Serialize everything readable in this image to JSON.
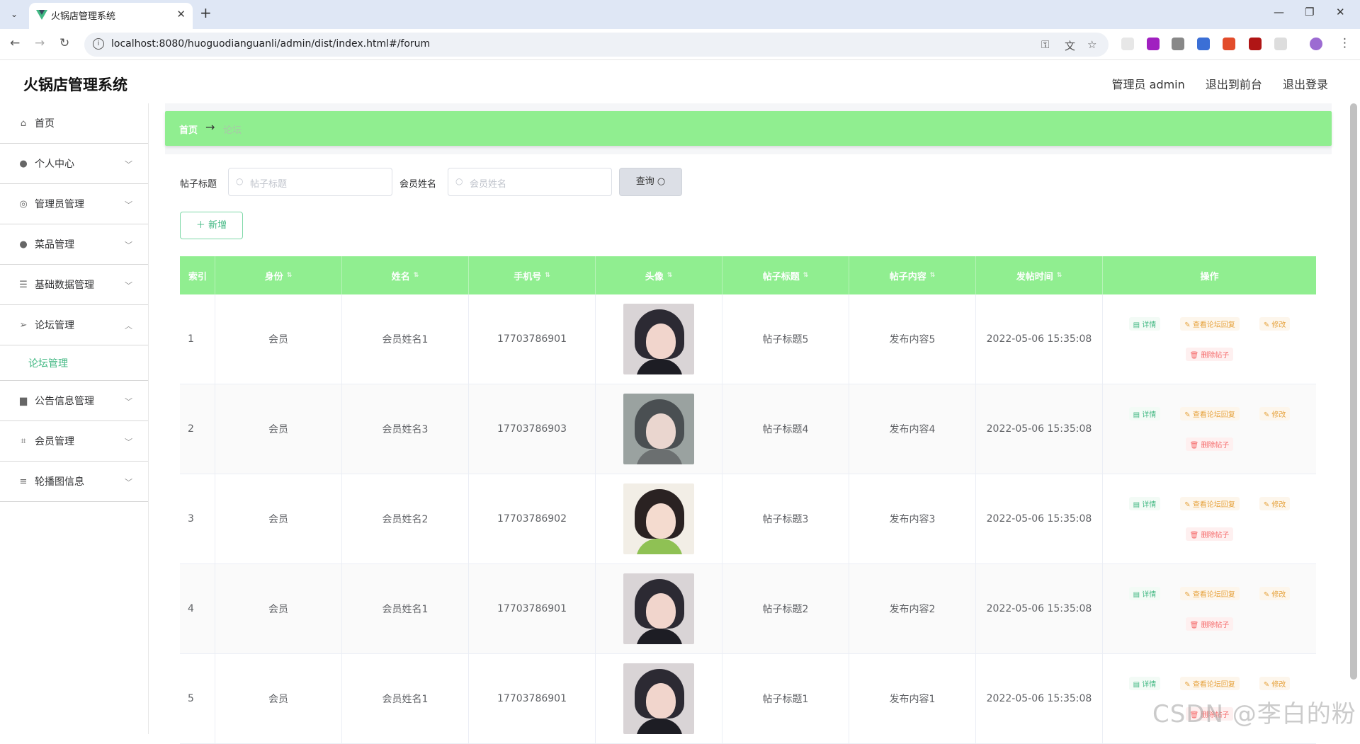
{
  "browser": {
    "tab_title": "火锅店管理系统",
    "url": "localhost:8080/huoguodianguanli/admin/dist/index.html#/forum"
  },
  "app": {
    "title": "火锅店管理系统",
    "admin_label": "管理员 admin",
    "goto_front": "退出到前台",
    "logout": "退出登录"
  },
  "sidebar": {
    "items": [
      {
        "label": "首页",
        "icon": "home-icon"
      },
      {
        "label": "个人中心",
        "icon": "user-icon"
      },
      {
        "label": "管理员管理",
        "icon": "compass-icon"
      },
      {
        "label": "菜品管理",
        "icon": "user-icon"
      },
      {
        "label": "基础数据管理",
        "icon": "list-icon"
      },
      {
        "label": "论坛管理",
        "icon": "send-icon"
      },
      {
        "label": "公告信息管理",
        "icon": "briefcase-icon"
      },
      {
        "label": "会员管理",
        "icon": "crop-icon"
      },
      {
        "label": "轮播图信息",
        "icon": "menu-icon"
      }
    ],
    "submenu_label": "论坛管理"
  },
  "breadcrumb": {
    "home": "首页",
    "current": "论坛"
  },
  "search": {
    "title_label": "帖子标题",
    "title_placeholder": "帖子标题",
    "name_label": "会员姓名",
    "name_placeholder": "会员姓名",
    "query_button": "查询"
  },
  "add_button": "新增",
  "table": {
    "headers": [
      "索引",
      "身份",
      "姓名",
      "手机号",
      "头像",
      "帖子标题",
      "帖子内容",
      "发帖时间",
      "操作"
    ],
    "rows": [
      {
        "index": "1",
        "role": "会员",
        "name": "会员姓名1",
        "phone": "17703786901",
        "title": "帖子标题5",
        "content": "发布内容5",
        "time": "2022-05-06 15:35:08",
        "avatar": "dark-hair"
      },
      {
        "index": "2",
        "role": "会员",
        "name": "会员姓名3",
        "phone": "17703786903",
        "title": "帖子标题4",
        "content": "发布内容4",
        "time": "2022-05-06 15:35:08",
        "avatar": "grey-hair"
      },
      {
        "index": "3",
        "role": "会员",
        "name": "会员姓名2",
        "phone": "17703786902",
        "title": "帖子标题3",
        "content": "发布内容3",
        "time": "2022-05-06 15:35:08",
        "avatar": "green-sweater"
      },
      {
        "index": "4",
        "role": "会员",
        "name": "会员姓名1",
        "phone": "17703786901",
        "title": "帖子标题2",
        "content": "发布内容2",
        "time": "2022-05-06 15:35:08",
        "avatar": "dark-hair"
      },
      {
        "index": "5",
        "role": "会员",
        "name": "会员姓名1",
        "phone": "17703786901",
        "title": "帖子标题1",
        "content": "发布内容1",
        "time": "2022-05-06 15:35:08",
        "avatar": "dark-hair"
      }
    ],
    "ops": {
      "detail": "详情",
      "reply": "查看论坛回复",
      "edit": "修改",
      "delete": "删除帖子"
    }
  },
  "watermark": "CSDN @李白的粉",
  "colors": {
    "accent": "#90ee90",
    "link": "#42b883"
  }
}
